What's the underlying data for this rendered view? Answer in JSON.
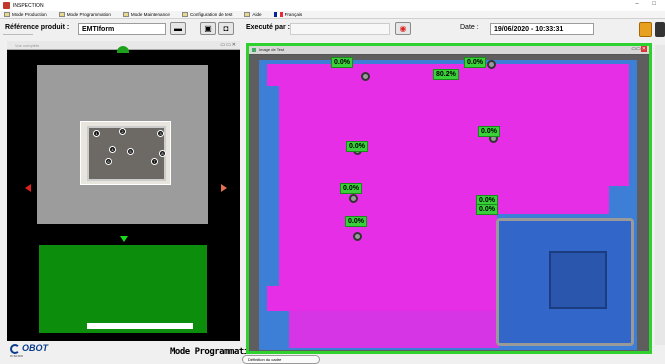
{
  "window": {
    "title": "INSPECTION"
  },
  "menu": [
    {
      "label": "Mode Production",
      "icon": "production-icon"
    },
    {
      "label": "Mode Programmation",
      "icon": "programming-icon"
    },
    {
      "label": "Mode Maintenance",
      "icon": "maintenance-icon"
    },
    {
      "label": "Configuration de test",
      "icon": "config-icon"
    },
    {
      "label": "Aide",
      "icon": "help-icon"
    },
    {
      "label": "Français",
      "icon": "flag-fr-icon"
    }
  ],
  "toolbar": {
    "reference_label": "Référence produit :",
    "reference_value": "EMTIform",
    "executed_label": "Executé par :",
    "executed_value": "",
    "date_label": "Date :",
    "date_value": "19/06/2020 - 10:33:31"
  },
  "left_panel": {
    "title": "Vue complète",
    "thumb_markers": [
      "1",
      "2",
      "3",
      "4",
      "5",
      "6",
      "7",
      "8"
    ]
  },
  "image_panel": {
    "title": "Image de Test",
    "labels": [
      "0.0%",
      "80.2%",
      "0.0%",
      "0.0%",
      "0.0%",
      "0.0%",
      "0.0%",
      "0.0%",
      "0.0%"
    ]
  },
  "footer": {
    "mode": "Mode Programmation",
    "frame_button": "Définition du cadre",
    "logo_text": "OBOT",
    "logo_sub": "VISION"
  },
  "colors": {
    "accent_green": "#2ed12e",
    "magenta": "#e62ee6",
    "pcb_blue": "#3d7fd6"
  }
}
